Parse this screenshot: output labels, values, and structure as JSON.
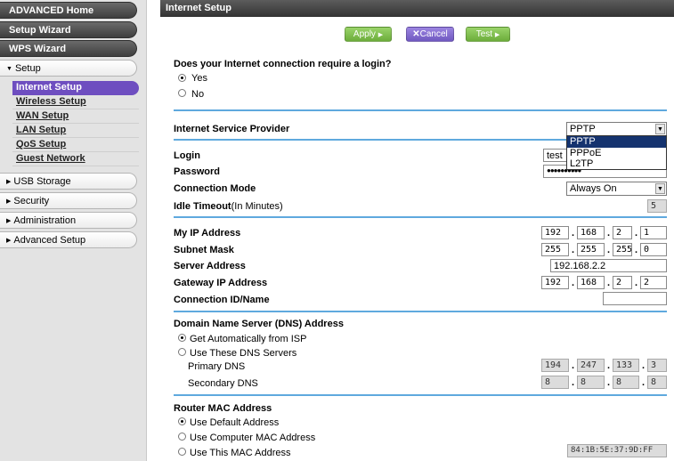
{
  "sidebar": {
    "advanced_home": "ADVANCED Home",
    "setup_wizard": "Setup Wizard",
    "wps_wizard": "WPS Wizard",
    "setup": "Setup",
    "setup_items": [
      "Internet Setup",
      "Wireless Setup",
      "WAN Setup",
      "LAN Setup",
      "QoS Setup",
      "Guest Network"
    ],
    "usb_storage": "USB Storage",
    "security": "Security",
    "administration": "Administration",
    "advanced_setup": "Advanced Setup"
  },
  "header": {
    "title": "Internet Setup"
  },
  "toolbar": {
    "apply": "Apply",
    "cancel": "Cancel",
    "test": "Test"
  },
  "login_question": {
    "text": "Does your Internet connection require a login?",
    "yes": "Yes",
    "no": "No",
    "selected": "Yes"
  },
  "isp": {
    "label": "Internet Service Provider",
    "value": "PPTP",
    "options": [
      "PPTP",
      "PPPoE",
      "L2TP"
    ]
  },
  "login": {
    "label": "Login",
    "value": "test"
  },
  "password": {
    "label": "Password",
    "value": "●●●●●●●●●●"
  },
  "connection_mode": {
    "label": "Connection Mode",
    "value": "Always On"
  },
  "idle_timeout": {
    "label": "Idle Timeout",
    "unit": "(In Minutes)",
    "value": "5"
  },
  "my_ip": {
    "label": "My IP Address",
    "octets": [
      "192",
      "168",
      "2",
      "1"
    ]
  },
  "subnet": {
    "label": "Subnet Mask",
    "octets": [
      "255",
      "255",
      "255",
      "0"
    ]
  },
  "server": {
    "label": "Server Address",
    "value": "192.168.2.2"
  },
  "gateway": {
    "label": "Gateway IP Address",
    "octets": [
      "192",
      "168",
      "2",
      "2"
    ]
  },
  "connection_id": {
    "label": "Connection ID/Name",
    "value": ""
  },
  "dns": {
    "title": "Domain Name Server (DNS) Address",
    "auto": "Get Automatically from ISP",
    "manual": "Use These DNS Servers",
    "selected": "Get Automatically from ISP",
    "primary_label": "Primary DNS",
    "primary": [
      "194",
      "247",
      "133",
      "3"
    ],
    "secondary_label": "Secondary DNS",
    "secondary": [
      "8",
      "8",
      "8",
      "8"
    ]
  },
  "mac": {
    "title": "Router MAC Address",
    "default": "Use Default Address",
    "computer": "Use Computer MAC Address",
    "this": "Use This MAC Address",
    "selected": "Use Default Address",
    "value": "84:1B:5E:37:9D:FF"
  },
  "colors": {
    "accent_rule": "#5fa9de",
    "active_nav": "#6e4ec0",
    "button_green": "#6cad3b",
    "button_purple": "#7059c1"
  }
}
